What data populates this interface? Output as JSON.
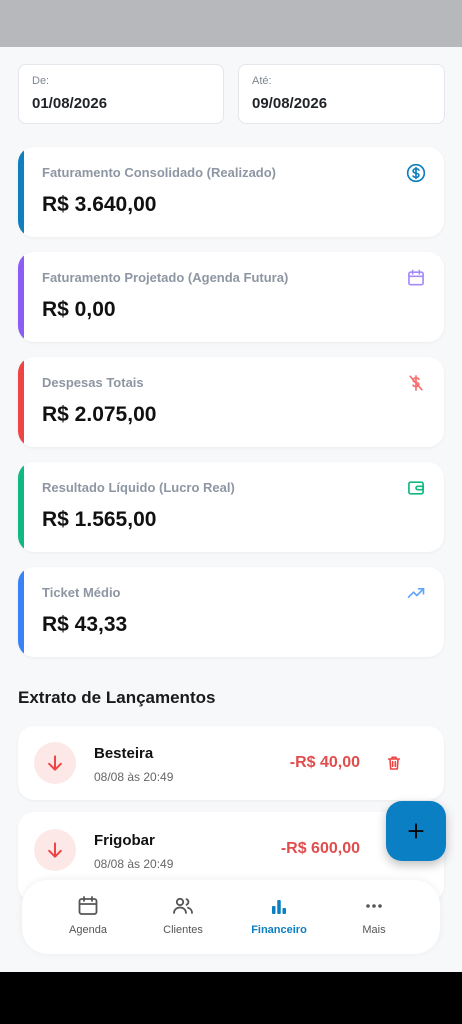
{
  "filters": {
    "from_label": "De:",
    "from_value": "01/08/2026",
    "to_label": "Até:",
    "to_value": "09/08/2026"
  },
  "cards": [
    {
      "title": "Faturamento Consolidado (Realizado)",
      "value": "R$ 3.640,00",
      "accent": "#0f7fbf",
      "icon": "dollar-circle-icon"
    },
    {
      "title": "Faturamento Projetado (Agenda Futura)",
      "value": "R$ 0,00",
      "accent": "#8b5cf6",
      "icon": "calendar-icon"
    },
    {
      "title": "Despesas Totais",
      "value": "R$ 2.075,00",
      "accent": "#ef4444",
      "icon": "dollar-off-icon"
    },
    {
      "title": "Resultado Líquido (Lucro Real)",
      "value": "R$ 1.565,00",
      "accent": "#10b981",
      "icon": "wallet-icon"
    },
    {
      "title": "Ticket Médio",
      "value": "R$ 43,33",
      "accent": "#3b82f6",
      "icon": "trending-up-icon"
    }
  ],
  "statement": {
    "title": "Extrato de Lançamentos",
    "items": [
      {
        "name": "Besteira",
        "time": "08/08 às 20:49",
        "amount": "-R$ 40,00"
      },
      {
        "name": "Frigobar",
        "time": "08/08 às 20:49",
        "amount": "-R$ 600,00"
      }
    ]
  },
  "nav": {
    "items": [
      {
        "label": "Agenda",
        "icon": "calendar-icon"
      },
      {
        "label": "Clientes",
        "icon": "users-icon"
      },
      {
        "label": "Financeiro",
        "icon": "bar-chart-icon",
        "active": true
      },
      {
        "label": "Mais",
        "icon": "more-dots-icon"
      }
    ]
  },
  "colors": {
    "primary": "#0b7fc4",
    "expense": "#e14d4d"
  }
}
